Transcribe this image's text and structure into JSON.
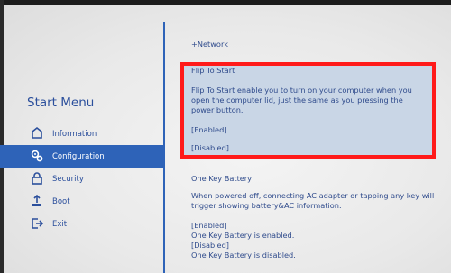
{
  "sidebar": {
    "title": "Start Menu",
    "items": [
      {
        "label": "Information",
        "icon": "info-icon",
        "active": false
      },
      {
        "label": "Configuration",
        "icon": "gear-icon",
        "active": true
      },
      {
        "label": "Security",
        "icon": "lock-icon",
        "active": false
      },
      {
        "label": "Boot",
        "icon": "boot-icon",
        "active": false
      },
      {
        "label": "Exit",
        "icon": "exit-icon",
        "active": false
      }
    ]
  },
  "main": {
    "network": "+Network",
    "flip": {
      "title": "Flip To Start",
      "description": "Flip To Start enable you to turn on your computer when you open the computer lid, just the same as you pressing the power button.",
      "option_enabled": "[Enabled]",
      "option_disabled": "[Disabled]"
    },
    "one_key_battery": {
      "title": "One Key Battery",
      "description": "When powered off, connecting AC adapter or tapping any key will trigger showing battery&AC information.",
      "option_enabled": "[Enabled]",
      "enabled_desc": "One Key Battery is enabled.",
      "option_disabled": "[Disabled]",
      "disabled_desc": "One Key Battery is disabled."
    }
  },
  "colors": {
    "accent": "#2e63b8",
    "text": "#2f4b8c",
    "highlight_panel": "#c9d6e6",
    "highlight_border": "#ff1a1a"
  }
}
